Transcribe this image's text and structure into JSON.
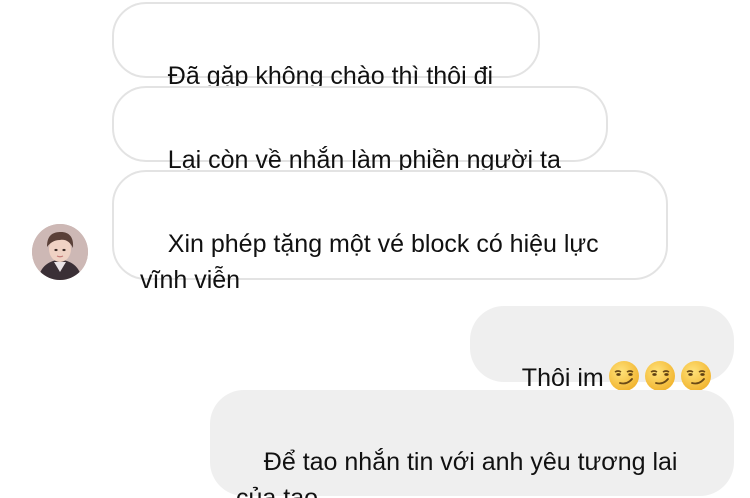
{
  "conversation": {
    "messages": [
      {
        "sender": "them",
        "text": "Đã gặp không chào thì thôi đi"
      },
      {
        "sender": "them",
        "text": "Lại còn về nhắn làm phiền người ta"
      },
      {
        "sender": "them",
        "text": "Xin phép tặng một vé block có hiệu lực\nvĩnh viễn"
      },
      {
        "sender": "me",
        "text": "Thôi im",
        "emoji_count": 3,
        "emoji": "smirking-face-emoji"
      },
      {
        "sender": "me",
        "text": "Để tao nhắn tin với anh yêu tương lai\ncủa tao"
      }
    ]
  },
  "colors": {
    "incoming_bubble": "#ffffff",
    "incoming_border": "#e3e3e3",
    "outgoing_bubble": "#efefef",
    "text": "#111111",
    "emoji_face": "#f7c948"
  }
}
